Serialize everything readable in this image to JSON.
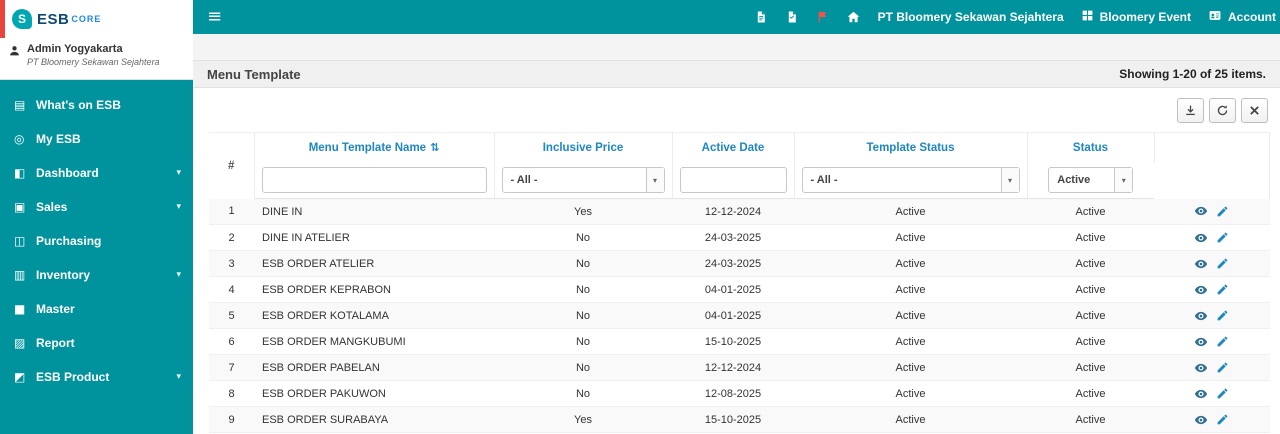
{
  "colors": {
    "accent": "#00939E",
    "header_blue": "#1D87C4",
    "alert_red": "#E8453C",
    "link_blue": "#1E88E5"
  },
  "brand": {
    "icon": "S",
    "name": "ESB",
    "suffix": "CORE"
  },
  "icons": {
    "hamburger": "≡",
    "chevron": "▾",
    "sort": "⇅",
    "caret": "▾"
  },
  "sidebar": {
    "user": {
      "name": "Admin Yogyakarta",
      "company": "PT Bloomery Sekawan Sejahtera"
    },
    "items": [
      {
        "id": "whats-on-esb",
        "label": "What's on ESB",
        "glyph": "▤",
        "expandable": false
      },
      {
        "id": "my-esb",
        "label": "My ESB",
        "glyph": "◎",
        "expandable": false
      },
      {
        "id": "dashboard",
        "label": "Dashboard",
        "glyph": "◧",
        "expandable": true
      },
      {
        "id": "sales",
        "label": "Sales",
        "glyph": "▣",
        "expandable": true
      },
      {
        "id": "purchasing",
        "label": "Purchasing",
        "glyph": "◫",
        "expandable": false
      },
      {
        "id": "inventory",
        "label": "Inventory",
        "glyph": "▥",
        "expandable": true
      },
      {
        "id": "master",
        "label": "Master",
        "glyph": "■",
        "expandable": false
      },
      {
        "id": "report",
        "label": "Report",
        "glyph": "▨",
        "expandable": false
      },
      {
        "id": "esb-product",
        "label": "ESB Product",
        "glyph": "◩",
        "expandable": true
      }
    ]
  },
  "navbar": {
    "company": "PT Bloomery Sekawan Sejahtera",
    "event": "Bloomery Event",
    "account": "Account"
  },
  "page": {
    "title": "Menu Template",
    "summary": "Showing 1-20 of 25 items."
  },
  "table": {
    "headers": {
      "no": "#",
      "name": "Menu Template Name",
      "inclusive": "Inclusive Price",
      "date": "Active Date",
      "template_status": "Template Status",
      "status": "Status"
    },
    "filters": {
      "all": "- All -",
      "status": "Active"
    },
    "rows": [
      {
        "no": "1",
        "name": "DINE IN",
        "inclusive": "Yes",
        "date": "12-12-2024",
        "template_status": "Active",
        "status": "Active"
      },
      {
        "no": "2",
        "name": "DINE IN ATELIER",
        "inclusive": "No",
        "date": "24-03-2025",
        "template_status": "Active",
        "status": "Active"
      },
      {
        "no": "3",
        "name": "ESB ORDER ATELIER",
        "inclusive": "No",
        "date": "24-03-2025",
        "template_status": "Active",
        "status": "Active"
      },
      {
        "no": "4",
        "name": "ESB ORDER KEPRABON",
        "inclusive": "No",
        "date": "04-01-2025",
        "template_status": "Active",
        "status": "Active"
      },
      {
        "no": "5",
        "name": "ESB ORDER KOTALAMA",
        "inclusive": "No",
        "date": "04-01-2025",
        "template_status": "Active",
        "status": "Active"
      },
      {
        "no": "6",
        "name": "ESB ORDER MANGKUBUMI",
        "inclusive": "No",
        "date": "15-10-2025",
        "template_status": "Active",
        "status": "Active"
      },
      {
        "no": "7",
        "name": "ESB ORDER PABELAN",
        "inclusive": "No",
        "date": "12-12-2024",
        "template_status": "Active",
        "status": "Active"
      },
      {
        "no": "8",
        "name": "ESB ORDER PAKUWON",
        "inclusive": "No",
        "date": "12-08-2025",
        "template_status": "Active",
        "status": "Active"
      },
      {
        "no": "9",
        "name": "ESB ORDER SURABAYA",
        "inclusive": "Yes",
        "date": "15-10-2025",
        "template_status": "Active",
        "status": "Active"
      }
    ]
  }
}
